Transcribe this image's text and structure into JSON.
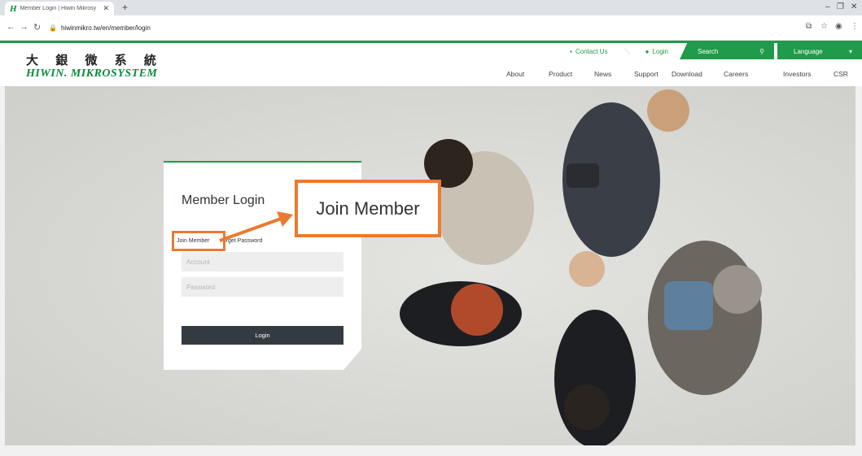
{
  "browser": {
    "tab_title": "Member Login | Hiwin Mikrosy",
    "tab_favicon": "H",
    "url": "hiwinmikro.tw/en/member/login"
  },
  "header": {
    "logo_cn": "大 銀 微 系 統",
    "logo_en": "HIWIN. MIKROSYSTEM",
    "contact_label": "Contact Us",
    "login_label": "Login",
    "search_label": "Search",
    "language_label": "Language",
    "nav": [
      "About",
      "Product",
      "News",
      "Support",
      "Download",
      "Careers",
      "Investors",
      "CSR"
    ]
  },
  "login_card": {
    "title": "Member Login",
    "join_member": "Join Member",
    "forget_password": "Forget Password",
    "forget_password_visible": "orget Password",
    "account_placeholder": "Account",
    "password_placeholder": "Password",
    "login_button": "Login"
  },
  "annotation": {
    "callout_text": "Join Member",
    "highlight_color": "#ec7a2e"
  },
  "colors": {
    "brand_green": "#1f9b49",
    "button_dark": "#333b41"
  }
}
